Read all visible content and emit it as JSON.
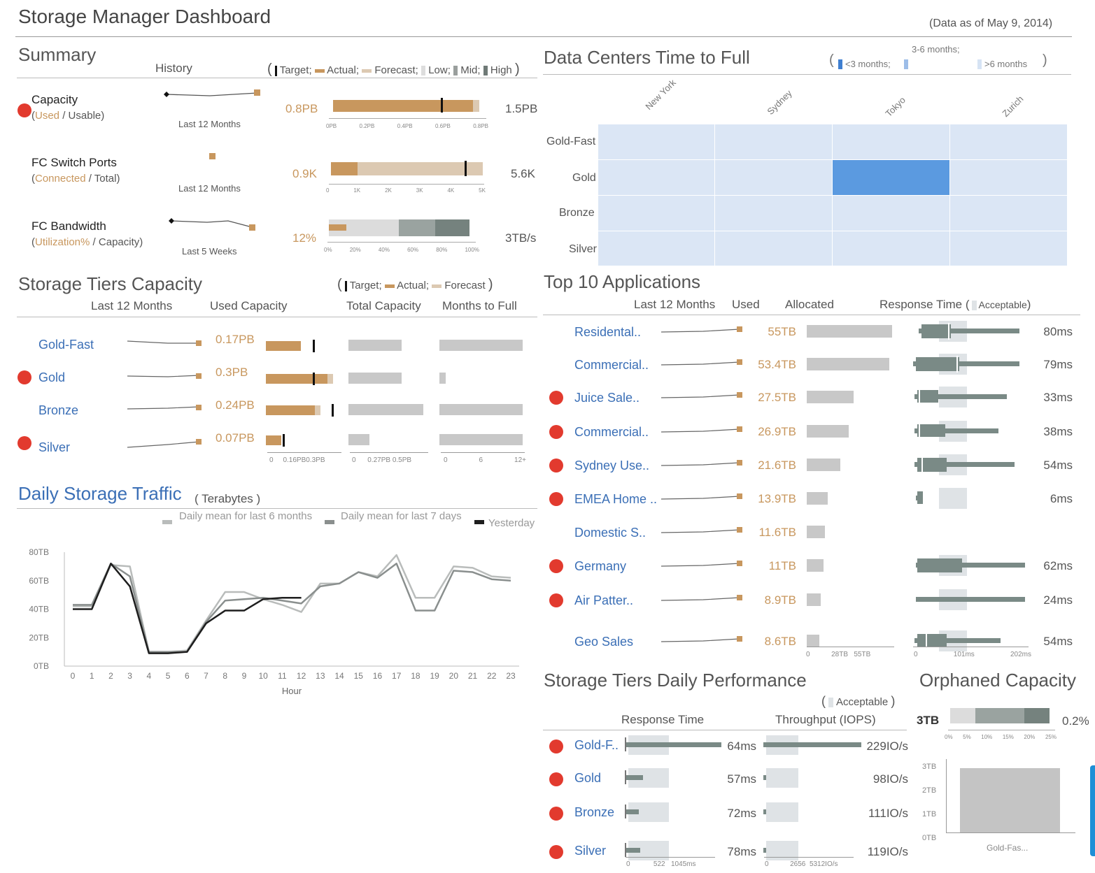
{
  "header": {
    "title": "Storage Manager Dashboard",
    "as_of": "(Data as of May 9, 2014)"
  },
  "summary": {
    "title": "Summary",
    "history_label": "History",
    "legend": {
      "open": "(",
      "target": "Target;",
      "actual": "Actual;",
      "forecast": "Forecast;",
      "low": "Low;",
      "mid": "Mid;",
      "high": "High",
      "close": ")"
    },
    "rows": [
      {
        "name": "Capacity",
        "sub_a": "Used",
        "sub_sep": " / ",
        "sub_b": "Usable)",
        "sub_open": "(",
        "period": "Last 12 Months",
        "actual": "0.8PB",
        "total": "1.5PB",
        "ticks": [
          "0PB",
          "0.2PB",
          "0.4PB",
          "0.6PB",
          "0.8PB"
        ]
      },
      {
        "name": "FC Switch Ports",
        "sub_a": "Connected",
        "sub_sep": " / ",
        "sub_b": "Total)",
        "sub_open": "(",
        "period": "Last 12 Months",
        "actual": "0.9K",
        "total": "5.6K",
        "ticks": [
          "0",
          "1K",
          "2K",
          "3K",
          "4K",
          "5K"
        ]
      },
      {
        "name": "FC Bandwidth",
        "sub_a": "Utilization%",
        "sub_sep": " / ",
        "sub_b": "Capacity)",
        "sub_open": "(",
        "period": "Last 5 Weeks",
        "actual": "12%",
        "total": "3TB/s",
        "ticks": [
          "0%",
          "20%",
          "40%",
          "60%",
          "80%",
          "100%"
        ]
      }
    ]
  },
  "datacenters": {
    "title": "Data Centers Time to Full",
    "legend": {
      "open": "(",
      "a": "<3 months;",
      "b": "3-6 months;",
      "c": ">6 months",
      "close": ")"
    },
    "columns": [
      "New York",
      "Sydney",
      "Tokyo",
      "Zurich"
    ],
    "rows": [
      "Gold-Fast",
      "Gold",
      "Bronze",
      "Silver"
    ]
  },
  "tiers": {
    "title": "Storage Tiers Capacity",
    "legend": {
      "open": "(",
      "target": "Target;",
      "actual": "Actual;",
      "forecast": "Forecast",
      "close": ")"
    },
    "headers": {
      "history": "Last 12 Months",
      "used": "Used Capacity",
      "total": "Total Capacity",
      "months": "Months to Full"
    },
    "rows": [
      {
        "name": "Gold-Fast",
        "used": "0.17PB"
      },
      {
        "name": "Gold",
        "used": "0.3PB"
      },
      {
        "name": "Bronze",
        "used": "0.24PB"
      },
      {
        "name": "Silver",
        "used": "0.07PB"
      }
    ],
    "used_ticks": [
      "0",
      "0.16PB",
      "0.3PB"
    ],
    "total_ticks": [
      "0",
      "0.27PB",
      "0.5PB"
    ],
    "months_ticks": [
      "0",
      "6",
      "12+"
    ]
  },
  "traffic": {
    "title": "Daily Storage Traffic",
    "unit": "( Terabytes )",
    "legend": [
      "Daily mean for last 6 months",
      "Daily mean for last 7 days",
      "Yesterday"
    ]
  },
  "apps": {
    "title": "Top 10 Applications",
    "headers": {
      "history": "Last 12 Months",
      "used": "Used",
      "allocated": "Allocated",
      "response": "Response Time (",
      "acceptable": "Acceptable",
      "close": ")"
    },
    "rows": [
      {
        "name": "Residental..",
        "used": "55TB",
        "rt": "80ms"
      },
      {
        "name": "Commercial..",
        "used": "53.4TB",
        "rt": "79ms"
      },
      {
        "name": "Juice Sale..",
        "used": "27.5TB",
        "rt": "33ms"
      },
      {
        "name": "Commercial..",
        "used": "26.9TB",
        "rt": "38ms"
      },
      {
        "name": "Sydney Use..",
        "used": "21.6TB",
        "rt": "54ms"
      },
      {
        "name": "EMEA Home ..",
        "used": "13.9TB",
        "rt": "6ms"
      },
      {
        "name": "Domestic S..",
        "used": "11.6TB",
        "rt": ""
      },
      {
        "name": "Germany",
        "used": "11TB",
        "rt": "62ms"
      },
      {
        "name": "Air Patter..",
        "used": "8.9TB",
        "rt": "24ms"
      },
      {
        "name": "Geo Sales",
        "used": "8.6TB",
        "rt": "54ms"
      }
    ],
    "alloc_ticks": [
      "0",
      "28TB",
      "55TB"
    ],
    "rt_ticks": [
      "0",
      "101ms",
      "202ms"
    ]
  },
  "perf": {
    "title": "Storage Tiers Daily Performance",
    "legend": {
      "open": "(",
      "acceptable": "Acceptable",
      "close": ")"
    },
    "headers": {
      "rt": "Response Time",
      "tp": "Throughput (IOPS)"
    },
    "rows": [
      {
        "name": "Gold-F..",
        "rt": "64ms",
        "tp": "229IO/s"
      },
      {
        "name": "Gold",
        "rt": "57ms",
        "tp": "98IO/s"
      },
      {
        "name": "Bronze",
        "rt": "72ms",
        "tp": "111IO/s"
      },
      {
        "name": "Silver",
        "rt": "78ms",
        "tp": "119IO/s"
      }
    ],
    "rt_ticks": [
      "0",
      "522",
      "1045ms"
    ],
    "tp_ticks": [
      "0",
      "2656",
      "5312IO/s"
    ]
  },
  "orphaned": {
    "title": "Orphaned Capacity",
    "total": "3TB",
    "pct": "0.2%",
    "ticks": [
      "0%",
      "5%",
      "10%",
      "15%",
      "20%",
      "25%"
    ],
    "y_ticks": [
      "3TB",
      "2TB",
      "1TB",
      "0TB"
    ],
    "bar_label": "Gold-Fas..."
  },
  "chart_data": {
    "type": "line",
    "title": "Daily Storage Traffic",
    "xlabel": "Hour",
    "ylabel": "",
    "ylim": [
      0,
      80
    ],
    "y_ticks": [
      "0TB",
      "20TB",
      "40TB",
      "60TB",
      "80TB"
    ],
    "x": [
      0,
      1,
      2,
      3,
      4,
      5,
      6,
      7,
      8,
      9,
      10,
      11,
      12,
      13,
      14,
      15,
      16,
      17,
      18,
      19,
      20,
      21,
      22,
      23
    ],
    "series": [
      {
        "name": "Daily mean for last 6 months",
        "color": "#b9bcbb",
        "values": [
          42,
          42,
          71,
          70,
          10,
          10,
          11,
          32,
          52,
          52,
          47,
          43,
          38,
          58,
          58,
          66,
          63,
          78,
          48,
          48,
          70,
          69,
          63,
          62
        ]
      },
      {
        "name": "Daily mean for last 7 days",
        "color": "#8a8f8e",
        "values": [
          43,
          43,
          72,
          63,
          10,
          10,
          10,
          31,
          46,
          47,
          48,
          46,
          44,
          56,
          58,
          66,
          62,
          72,
          39,
          39,
          67,
          66,
          61,
          60
        ]
      },
      {
        "name": "Yesterday",
        "color": "#1e1e1e",
        "values": [
          40,
          40,
          72,
          56,
          9,
          9,
          10,
          30,
          39,
          39,
          47,
          48,
          48
        ]
      }
    ]
  }
}
